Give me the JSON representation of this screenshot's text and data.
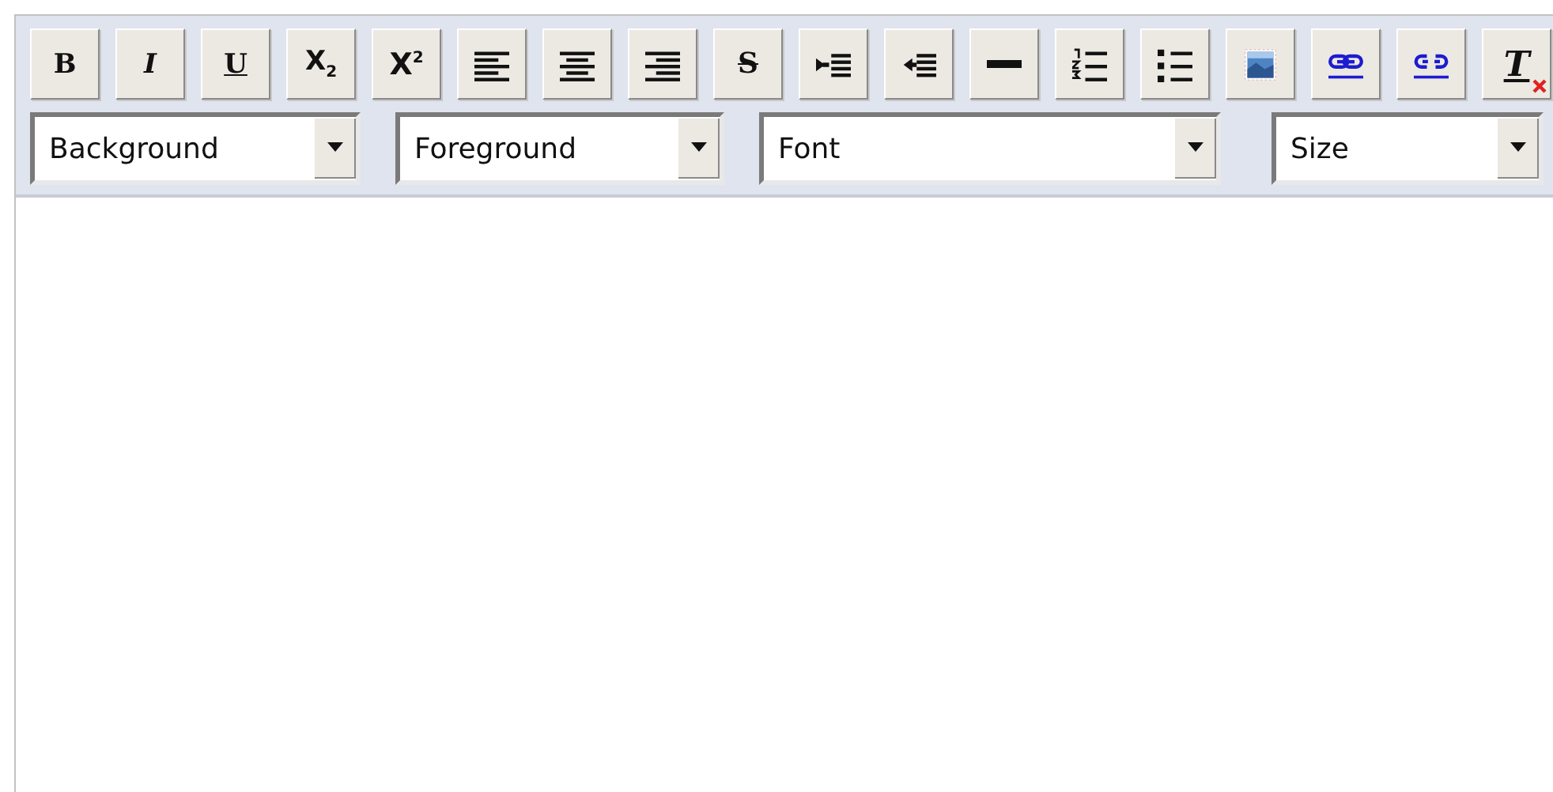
{
  "toolbar": {
    "buttons": [
      {
        "kind": "bold",
        "label": "B"
      },
      {
        "kind": "italic",
        "label": "I"
      },
      {
        "kind": "underline",
        "label": "U"
      },
      {
        "kind": "subscript",
        "label": "X$_{2}$"
      },
      {
        "kind": "superscript",
        "label": "X$^{2}$"
      },
      {
        "kind": "align-left"
      },
      {
        "kind": "align-center"
      },
      {
        "kind": "align-right"
      },
      {
        "kind": "strikethrough",
        "label": "S"
      },
      {
        "kind": "indent"
      },
      {
        "kind": "outdent"
      },
      {
        "kind": "horizontal-rule"
      },
      {
        "kind": "ordered-list"
      },
      {
        "kind": "bullet-list"
      },
      {
        "kind": "image"
      },
      {
        "kind": "link"
      },
      {
        "kind": "unlink"
      },
      {
        "kind": "remove-format",
        "label": "T"
      }
    ],
    "selects": [
      {
        "kind": "background",
        "value": "Background"
      },
      {
        "kind": "foreground",
        "value": "Foreground"
      },
      {
        "kind": "font",
        "value": "Font"
      },
      {
        "kind": "size",
        "value": "Size"
      }
    ]
  }
}
